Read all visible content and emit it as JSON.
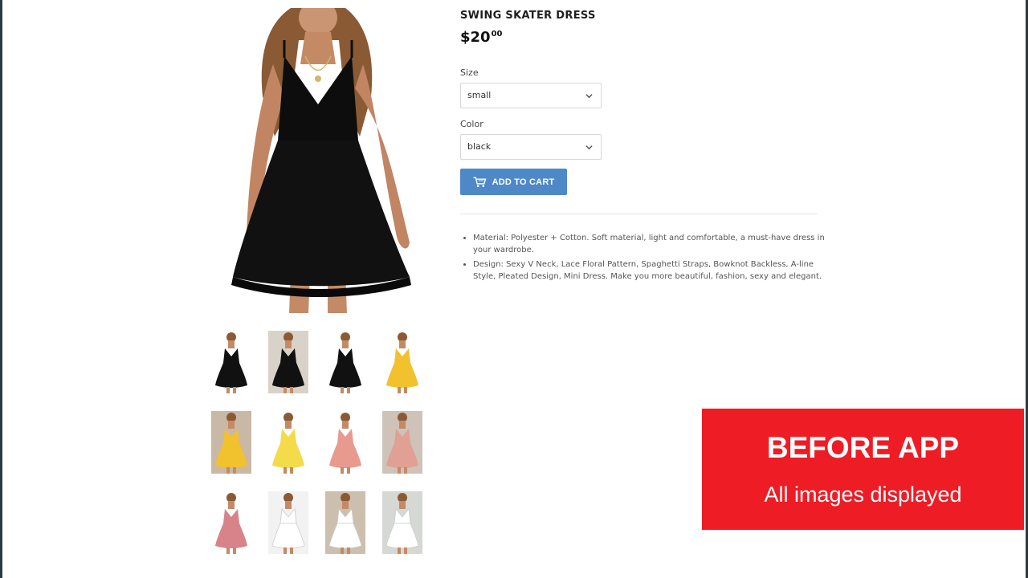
{
  "product": {
    "title": "SWING SKATER DRESS",
    "price_main": "$20",
    "price_cents": "00"
  },
  "options": {
    "size_label": "Size",
    "size_value": "small",
    "color_label": "Color",
    "color_value": "black"
  },
  "cart": {
    "add_label": "ADD TO CART"
  },
  "description": [
    "Material: Polyester + Cotton. Soft material, light and comfortable, a must-have dress in your wardrobe.",
    "Design: Sexy V Neck, Lace Floral Pattern, Spaghetti Straps, Bowknot Backless, A-line Style, Pleated Design, Mini Dress. Make you more beautiful, fashion, sexy and elegant."
  ],
  "thumbnails": [
    {
      "color": "#111111",
      "bg": "#ffffff"
    },
    {
      "color": "#111111",
      "bg": "#d9d2c8"
    },
    {
      "color": "#111111",
      "bg": "#ffffff"
    },
    {
      "color": "#f2c12e",
      "bg": "#ffffff"
    },
    {
      "color": "#f2c12e",
      "bg": "#c9b8a6"
    },
    {
      "color": "#f4db4a",
      "bg": "#ffffff"
    },
    {
      "color": "#e89a8e",
      "bg": "#ffffff"
    },
    {
      "color": "#e0a093",
      "bg": "#cfc2b8"
    },
    {
      "color": "#d8838a",
      "bg": "#ffffff"
    },
    {
      "color": "#ffffff",
      "bg": "#f2f2f2"
    },
    {
      "color": "#ffffff",
      "bg": "#cdbfae"
    },
    {
      "color": "#ffffff",
      "bg": "#d5d8d3"
    }
  ],
  "banner": {
    "title": "BEFORE APP",
    "subtitle": "All images displayed",
    "color": "#ee1c25"
  },
  "icons": {
    "cart": "cart-icon",
    "chevron": "chevron-down-icon"
  }
}
